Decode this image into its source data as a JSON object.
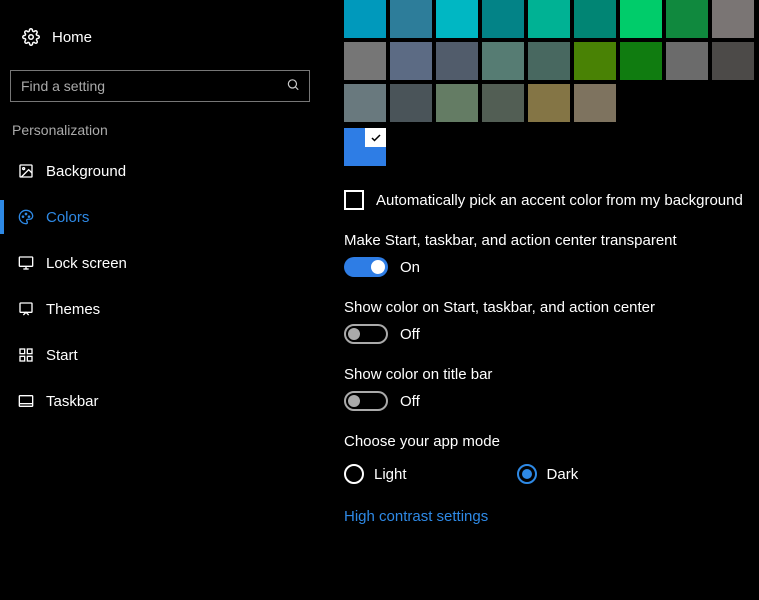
{
  "sidebar": {
    "home": "Home",
    "search_placeholder": "Find a setting",
    "category": "Personalization",
    "items": [
      {
        "label": "Background"
      },
      {
        "label": "Colors"
      },
      {
        "label": "Lock screen"
      },
      {
        "label": "Themes"
      },
      {
        "label": "Start"
      },
      {
        "label": "Taskbar"
      }
    ]
  },
  "palette": {
    "rows": [
      [
        "#0099bc",
        "#2d7d9a",
        "#00b7c3",
        "#038387",
        "#00b294",
        "#018574",
        "#00cc6a",
        "#10893e"
      ],
      [
        "#7a7574",
        "#767676",
        "#5c6b84",
        "#515c6b",
        "#567c73",
        "#486860",
        "#498205",
        "#107c10"
      ],
      [
        "#6b6b6b",
        "#4c4a48",
        "#69797e",
        "#4a5459",
        "#647c64",
        "#525e54",
        "#847545",
        "#7e735f"
      ]
    ],
    "selected_color": "#2e7de5"
  },
  "settings": {
    "auto_pick": {
      "label": "Automatically pick an accent color from my background",
      "checked": false
    },
    "transparent": {
      "label": "Make Start, taskbar, and action center transparent",
      "on": true,
      "state": "On"
    },
    "show_color_start": {
      "label": "Show color on Start, taskbar, and action center",
      "on": false,
      "state": "Off"
    },
    "show_color_title": {
      "label": "Show color on title bar",
      "on": false,
      "state": "Off"
    },
    "app_mode": {
      "label": "Choose your app mode",
      "options": {
        "light": "Light",
        "dark": "Dark"
      },
      "selected": "dark"
    },
    "high_contrast_link": "High contrast settings"
  }
}
